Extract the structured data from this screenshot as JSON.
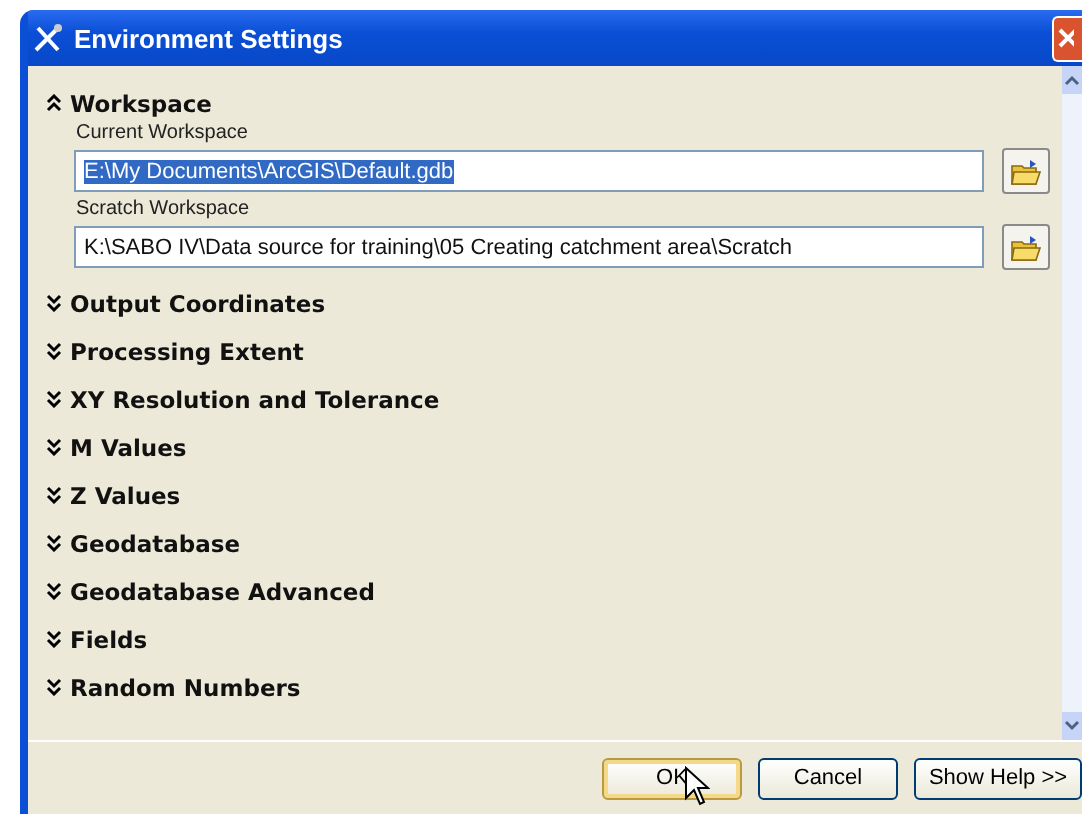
{
  "window": {
    "title": "Environment Settings"
  },
  "sections": [
    {
      "title": "Workspace",
      "expanded": true,
      "fields": [
        {
          "label": "Current Workspace",
          "value": "E:\\My Documents\\ArcGIS\\Default.gdb",
          "selected": true
        },
        {
          "label": "Scratch Workspace",
          "value": "K:\\SABO IV\\Data source for training\\05 Creating catchment area\\Scratch",
          "selected": false
        }
      ]
    },
    {
      "title": "Output Coordinates",
      "expanded": false
    },
    {
      "title": "Processing Extent",
      "expanded": false
    },
    {
      "title": "XY Resolution and Tolerance",
      "expanded": false
    },
    {
      "title": "M Values",
      "expanded": false
    },
    {
      "title": "Z Values",
      "expanded": false
    },
    {
      "title": "Geodatabase",
      "expanded": false
    },
    {
      "title": "Geodatabase Advanced",
      "expanded": false
    },
    {
      "title": "Fields",
      "expanded": false
    },
    {
      "title": "Random Numbers",
      "expanded": false
    }
  ],
  "buttons": [
    {
      "label": "OK",
      "default": true
    },
    {
      "label": "Cancel",
      "default": false
    },
    {
      "label": "Show Help >>",
      "default": false
    }
  ]
}
